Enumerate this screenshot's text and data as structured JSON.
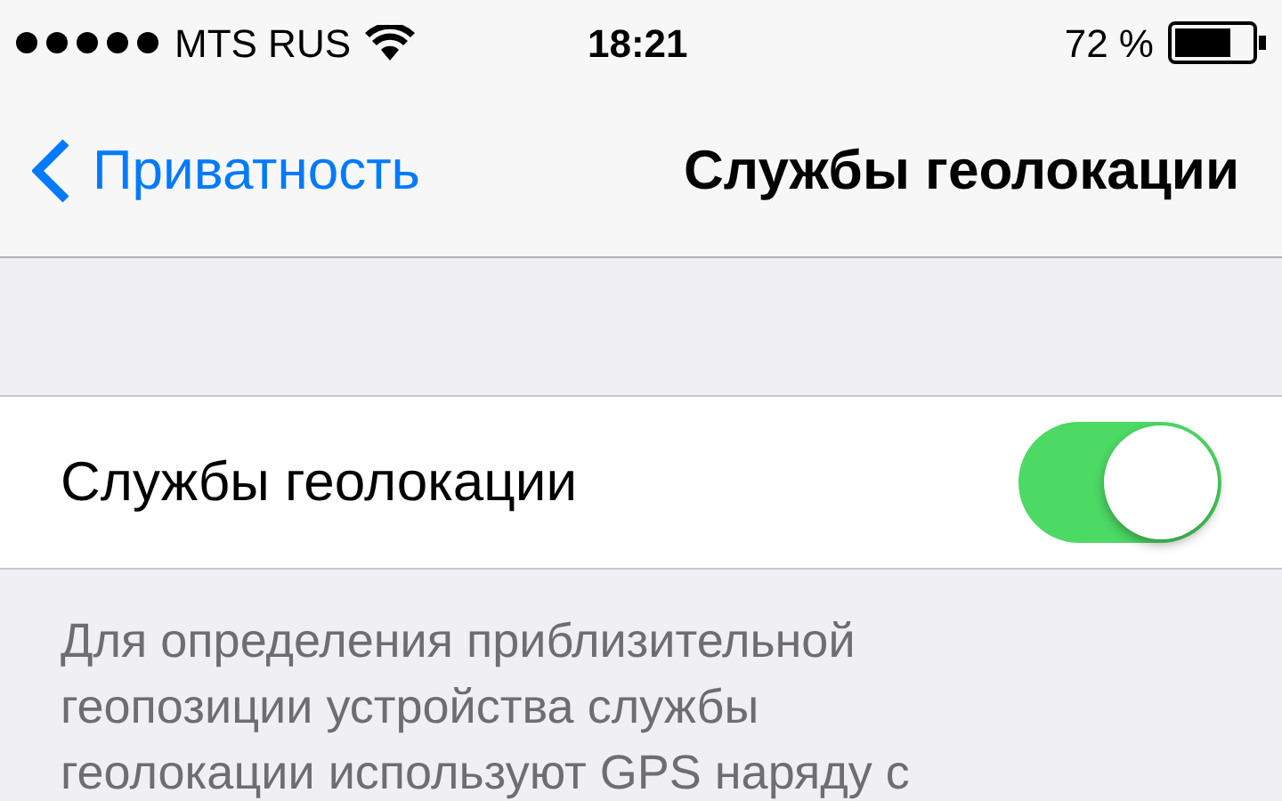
{
  "status_bar": {
    "carrier": "MTS RUS",
    "time": "18:21",
    "battery": "72 %"
  },
  "nav_bar": {
    "back": "Приватность",
    "title": "Службы геолокации"
  },
  "settings": [
    {
      "label": "Службы геолокации",
      "kind": "toggle",
      "on": true
    }
  ],
  "footer": "Для определения приблизительной\nгеопозиции устройства службы\nгеолокации используют GPS наряду с"
}
